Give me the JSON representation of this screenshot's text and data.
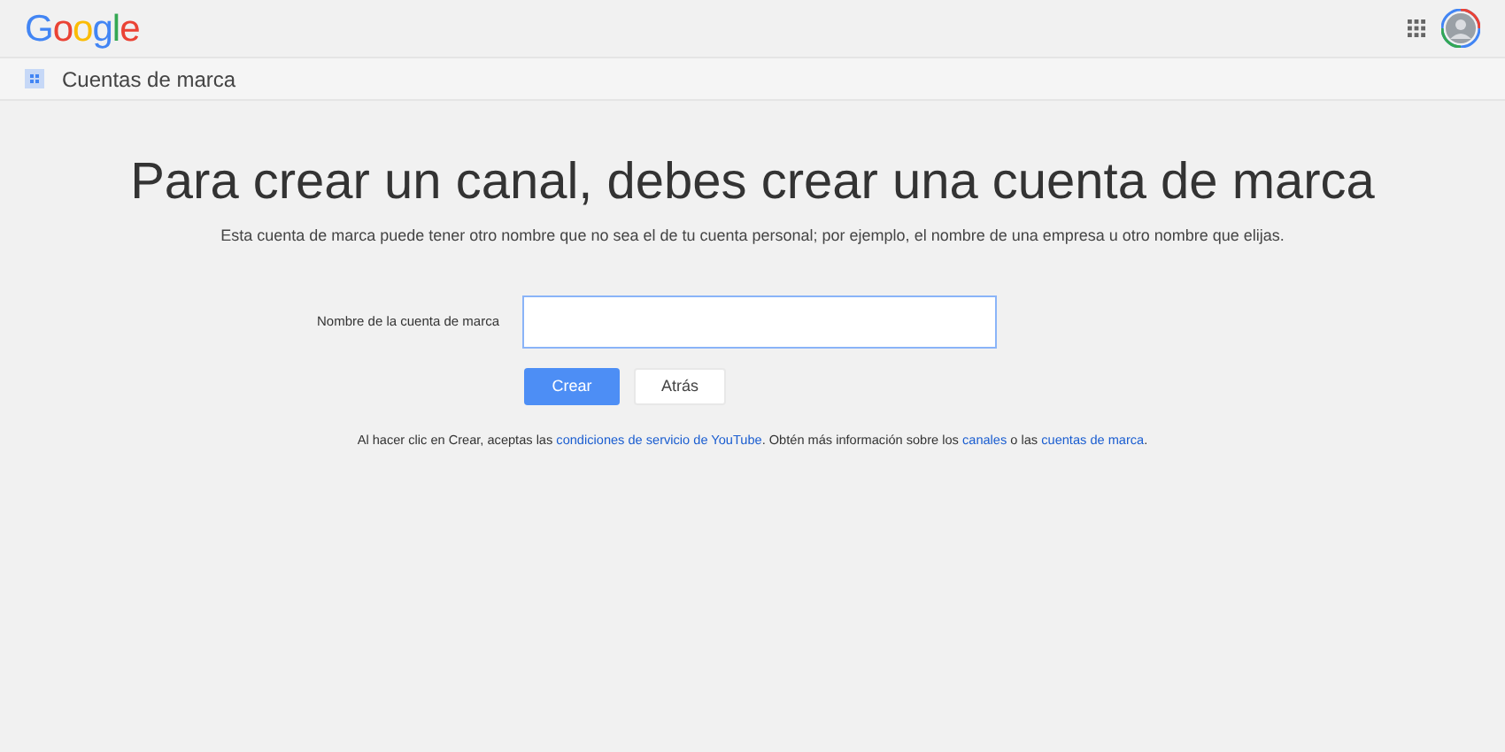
{
  "header": {
    "logo": "Google"
  },
  "subheader": {
    "title": "Cuentas de marca"
  },
  "main": {
    "heading": "Para crear un canal, debes crear una cuenta de marca",
    "subtitle": "Esta cuenta de marca puede tener otro nombre que no sea el de tu cuenta personal; por ejemplo, el nombre de una empresa u otro nombre que elijas.",
    "field": {
      "label": "Nombre de la cuenta de marca",
      "focused": true
    },
    "buttons": [
      {
        "label": "Crear",
        "kind": "primary"
      },
      {
        "label": "Atrás",
        "kind": "secondary"
      }
    ],
    "footer": [
      {
        "kind": "text",
        "text": "Al hacer clic en Crear, aceptas las "
      },
      {
        "kind": "link",
        "text": "condiciones de servicio de YouTube"
      },
      {
        "kind": "text",
        "text": ". Obtén más información sobre los "
      },
      {
        "kind": "link",
        "text": "canales"
      },
      {
        "kind": "text",
        "text": " o las "
      },
      {
        "kind": "link",
        "text": "cuentas de marca"
      },
      {
        "kind": "text",
        "text": "."
      }
    ]
  }
}
